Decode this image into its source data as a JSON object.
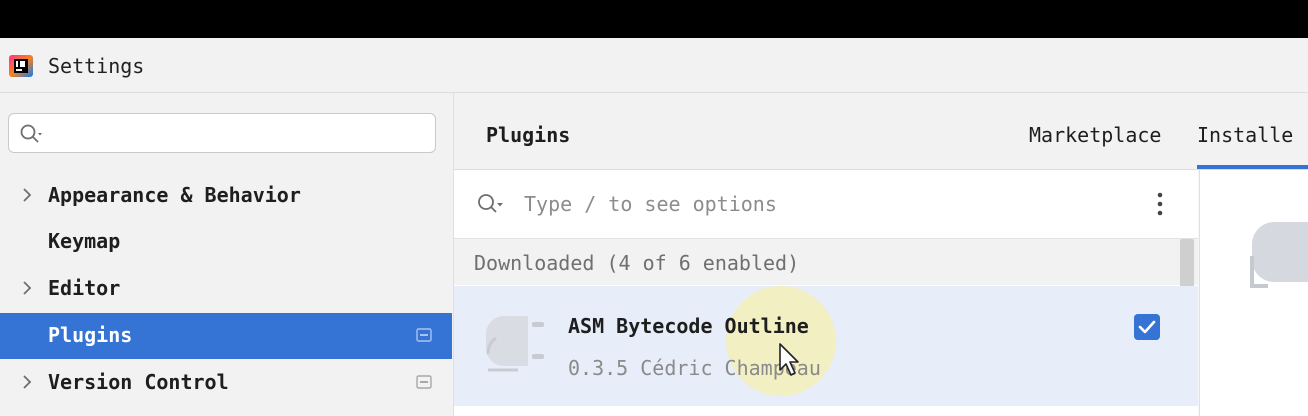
{
  "window": {
    "title": "Settings"
  },
  "sidebar": {
    "search": {
      "placeholder": ""
    },
    "items": [
      {
        "label": "Appearance & Behavior",
        "expandable": true,
        "selected": false,
        "project_icon": false
      },
      {
        "label": "Keymap",
        "expandable": false,
        "selected": false,
        "project_icon": false
      },
      {
        "label": "Editor",
        "expandable": true,
        "selected": false,
        "project_icon": false
      },
      {
        "label": "Plugins",
        "expandable": false,
        "selected": true,
        "project_icon": true
      },
      {
        "label": "Version Control",
        "expandable": true,
        "selected": false,
        "project_icon": true
      }
    ]
  },
  "main": {
    "title": "Plugins",
    "tabs": [
      {
        "label": "Marketplace",
        "active": false
      },
      {
        "label": "Installe",
        "active": true
      }
    ],
    "search": {
      "placeholder": "Type / to see options"
    },
    "group_header": "Downloaded (4 of 6 enabled)",
    "plugins": [
      {
        "name": "ASM Bytecode Outline",
        "version": "0.3.5",
        "author": "Cédric Champeau",
        "enabled": true
      }
    ]
  },
  "icons": {
    "app": "intellij-app-icon",
    "search": "search-icon",
    "chevron": "chevron-right-icon",
    "project": "project-level-icon",
    "more": "kebab-menu-icon",
    "plugin": "plugin-plug-icon",
    "check": "checkmark-icon",
    "cursor": "mouse-cursor-icon"
  },
  "colors": {
    "accent": "#3574d5",
    "selection_row": "#e8eef9"
  }
}
